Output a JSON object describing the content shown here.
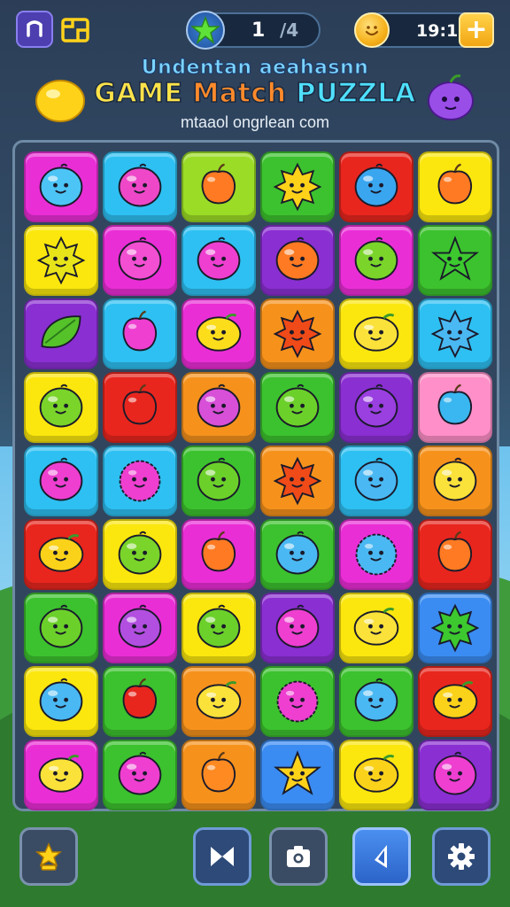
{
  "header": {
    "level_current": "1",
    "level_total": "/4",
    "coins": "19:1",
    "plus_label": "+"
  },
  "title_block": {
    "subtitle": "Undentan aeahasnn",
    "title_game": "GAME",
    "title_match": "Match",
    "title_puzzle": "PUZZLA",
    "url": "mtaaol ongrlean com"
  },
  "colors": {
    "magenta": "#ea2ed6",
    "cyan": "#2ec0f2",
    "lime": "#9bdc26",
    "green": "#3cc22e",
    "red": "#e8261e",
    "yellow": "#fbe70e",
    "purple": "#8a2fd2",
    "orange": "#f6921c",
    "pink": "#ff8fc8",
    "blue": "#3a8cf2"
  },
  "board": [
    [
      {
        "bg": "magenta",
        "fruit": "round",
        "fc": "#4cc4f6"
      },
      {
        "bg": "cyan",
        "fruit": "round",
        "fc": "#ee48c8"
      },
      {
        "bg": "lime",
        "fruit": "apple",
        "fc": "#ff7a22"
      },
      {
        "bg": "green",
        "fruit": "star",
        "fc": "#ffd21a"
      },
      {
        "bg": "red",
        "fruit": "round",
        "fc": "#3aa6f0"
      },
      {
        "bg": "yellow",
        "fruit": "apple",
        "fc": "#ff7a22"
      }
    ],
    [
      {
        "bg": "yellow",
        "fruit": "star",
        "fc": "#e8e41a"
      },
      {
        "bg": "magenta",
        "fruit": "round",
        "fc": "#f24fd2"
      },
      {
        "bg": "cyan",
        "fruit": "round",
        "fc": "#ee3fd0"
      },
      {
        "bg": "purple",
        "fruit": "round",
        "fc": "#ff7a22"
      },
      {
        "bg": "magenta",
        "fruit": "round",
        "fc": "#7ad42a"
      },
      {
        "bg": "green",
        "fruit": "star5",
        "fc": "#3cc82e"
      }
    ],
    [
      {
        "bg": "purple",
        "fruit": "leaf",
        "fc": "#55c22a"
      },
      {
        "bg": "cyan",
        "fruit": "apple",
        "fc": "#ee3fd0"
      },
      {
        "bg": "magenta",
        "fruit": "lemon",
        "fc": "#fbdd1c"
      },
      {
        "bg": "orange",
        "fruit": "star",
        "fc": "#ef4a18"
      },
      {
        "bg": "yellow",
        "fruit": "lemon",
        "fc": "#fbe23a"
      },
      {
        "bg": "cyan",
        "fruit": "star",
        "fc": "#4ab8f2"
      }
    ],
    [
      {
        "bg": "yellow",
        "fruit": "round",
        "fc": "#7ad42a"
      },
      {
        "bg": "red",
        "fruit": "apple",
        "fc": "#e8261e"
      },
      {
        "bg": "orange",
        "fruit": "round",
        "fc": "#d84fd8"
      },
      {
        "bg": "green",
        "fruit": "round",
        "fc": "#6cd02a"
      },
      {
        "bg": "purple",
        "fruit": "round",
        "fc": "#9a3fe0"
      },
      {
        "bg": "pink",
        "fruit": "apple",
        "fc": "#3ab6f0"
      }
    ],
    [
      {
        "bg": "cyan",
        "fruit": "round",
        "fc": "#ee3fd0"
      },
      {
        "bg": "cyan",
        "fruit": "berry",
        "fc": "#ee3fd0"
      },
      {
        "bg": "green",
        "fruit": "round",
        "fc": "#6cd02a"
      },
      {
        "bg": "orange",
        "fruit": "star",
        "fc": "#ef4a18"
      },
      {
        "bg": "cyan",
        "fruit": "round",
        "fc": "#4ab8f2"
      },
      {
        "bg": "orange",
        "fruit": "round",
        "fc": "#fbe23a"
      }
    ],
    [
      {
        "bg": "red",
        "fruit": "lemon",
        "fc": "#fbd21a"
      },
      {
        "bg": "yellow",
        "fruit": "round",
        "fc": "#7ad42a"
      },
      {
        "bg": "magenta",
        "fruit": "apple",
        "fc": "#ff7a22"
      },
      {
        "bg": "green",
        "fruit": "round",
        "fc": "#4ab8f2"
      },
      {
        "bg": "magenta",
        "fruit": "berry",
        "fc": "#4ab8f2"
      },
      {
        "bg": "red",
        "fruit": "apple",
        "fc": "#ff7a22"
      }
    ],
    [
      {
        "bg": "green",
        "fruit": "round",
        "fc": "#6cd02a"
      },
      {
        "bg": "magenta",
        "fruit": "round",
        "fc": "#b24fe0"
      },
      {
        "bg": "yellow",
        "fruit": "round",
        "fc": "#6cd02a"
      },
      {
        "bg": "purple",
        "fruit": "round",
        "fc": "#ee3fd0"
      },
      {
        "bg": "yellow",
        "fruit": "lemon",
        "fc": "#fbe23a"
      },
      {
        "bg": "blue",
        "fruit": "star",
        "fc": "#3cc82e"
      }
    ],
    [
      {
        "bg": "yellow",
        "fruit": "round",
        "fc": "#4ab8f2"
      },
      {
        "bg": "green",
        "fruit": "apple",
        "fc": "#e8261e"
      },
      {
        "bg": "orange",
        "fruit": "lemon",
        "fc": "#fbe23a"
      },
      {
        "bg": "green",
        "fruit": "berry",
        "fc": "#ee3fd0"
      },
      {
        "bg": "green",
        "fruit": "round",
        "fc": "#4ab8f2"
      },
      {
        "bg": "red",
        "fruit": "lemon",
        "fc": "#fbd21a"
      }
    ],
    [
      {
        "bg": "magenta",
        "fruit": "lemon",
        "fc": "#fbe23a"
      },
      {
        "bg": "green",
        "fruit": "round",
        "fc": "#ee3fd0"
      },
      {
        "bg": "orange",
        "fruit": "apple",
        "fc": "#ff8a22"
      },
      {
        "bg": "blue",
        "fruit": "star5",
        "fc": "#ffd21a"
      },
      {
        "bg": "yellow",
        "fruit": "lemon",
        "fc": "#fbd21a"
      },
      {
        "bg": "purple",
        "fruit": "round",
        "fc": "#ee3fd0"
      }
    ]
  ],
  "bottom_bar": [
    "trophy-icon",
    "bowtie-icon",
    "camera-icon",
    "back-icon",
    "gear-icon"
  ]
}
